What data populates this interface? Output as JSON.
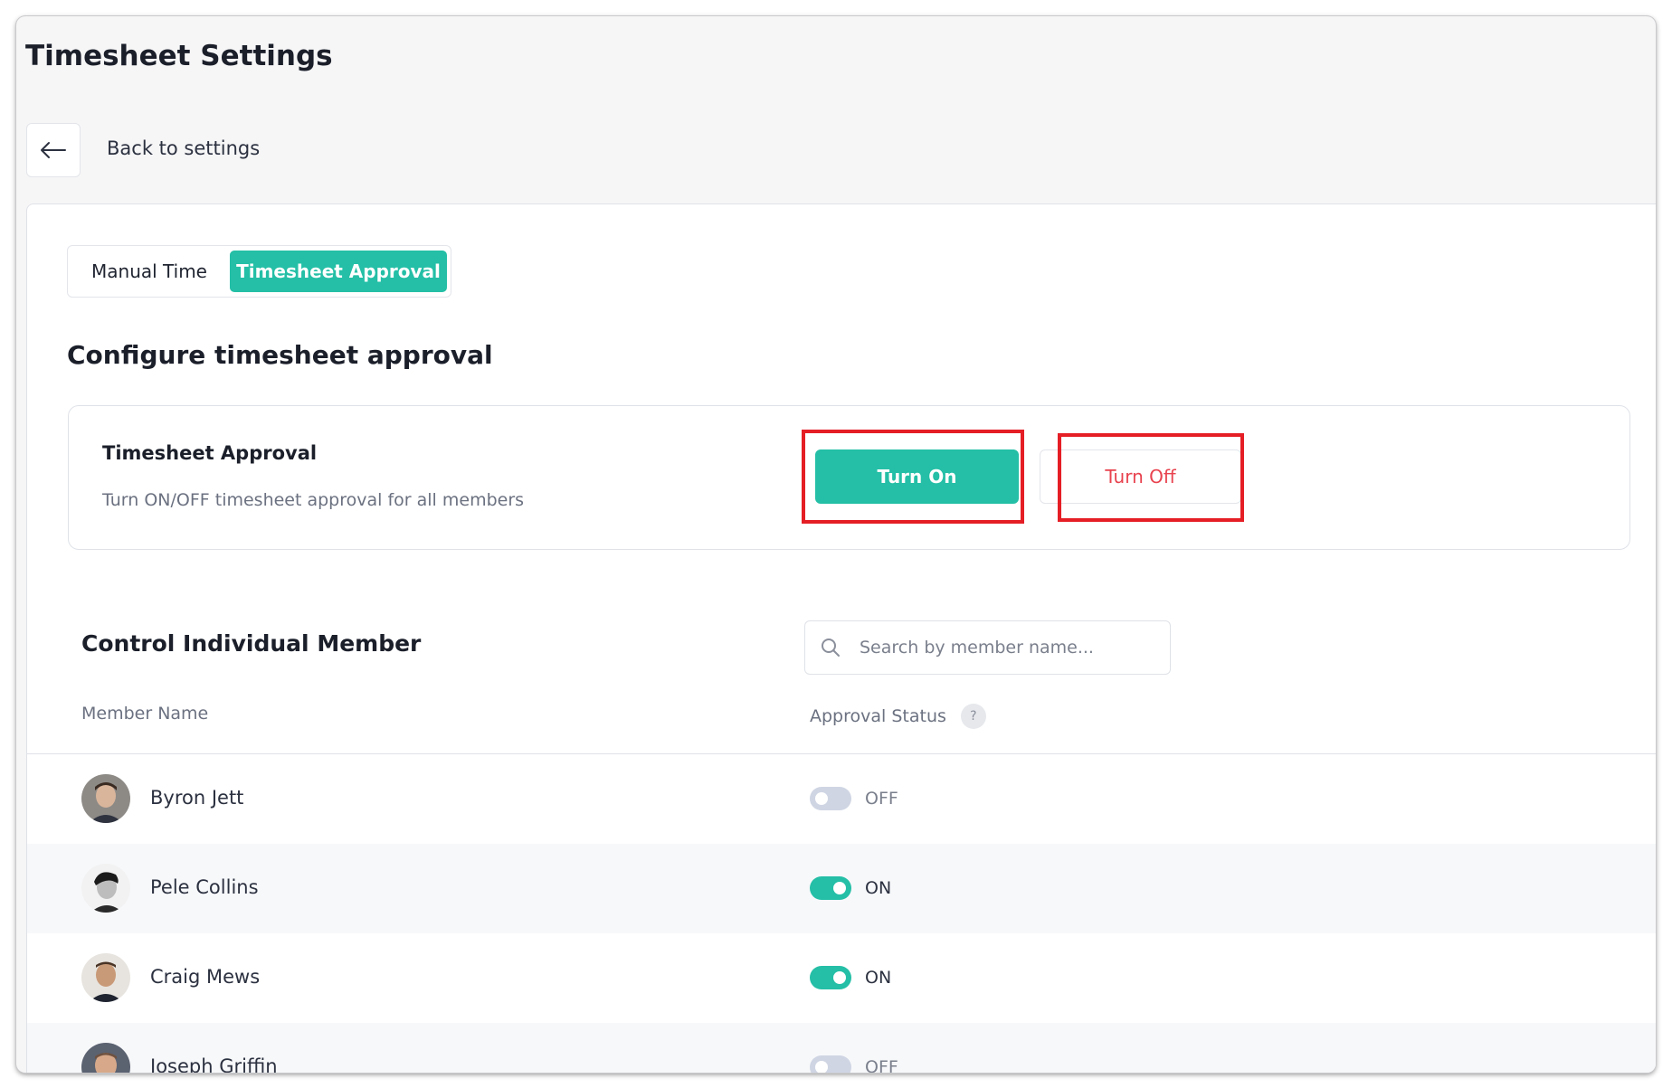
{
  "page": {
    "title": "Timesheet Settings"
  },
  "navigation": {
    "back_label": "Back to settings"
  },
  "tabs": [
    {
      "label": "Manual Time",
      "active": false
    },
    {
      "label": "Timesheet Approval",
      "active": true
    }
  ],
  "section": {
    "title": "Configure timesheet approval"
  },
  "approval_card": {
    "title": "Timesheet Approval",
    "description": "Turn ON/OFF timesheet approval for all members",
    "turn_on_label": "Turn On",
    "turn_off_label": "Turn Off"
  },
  "members": {
    "title": "Control Individual Member",
    "search_placeholder": "Search by member name...",
    "search_value": "",
    "columns": {
      "name": "Member Name",
      "status": "Approval Status",
      "help": "?"
    },
    "rows": [
      {
        "name": "Byron Jett",
        "status": "OFF",
        "enabled": false
      },
      {
        "name": "Pele Collins",
        "status": "ON",
        "enabled": true
      },
      {
        "name": "Craig Mews",
        "status": "ON",
        "enabled": true
      },
      {
        "name": "Joseph Griffin",
        "status": "OFF",
        "enabled": false
      }
    ]
  },
  "colors": {
    "accent": "#24bfa6",
    "danger_text": "#e8434f",
    "highlight_box": "#e51e25",
    "toggle_off": "#cfd5e3"
  },
  "icons": {
    "back": "arrow-left-icon",
    "search": "search-icon",
    "help": "help-icon"
  }
}
